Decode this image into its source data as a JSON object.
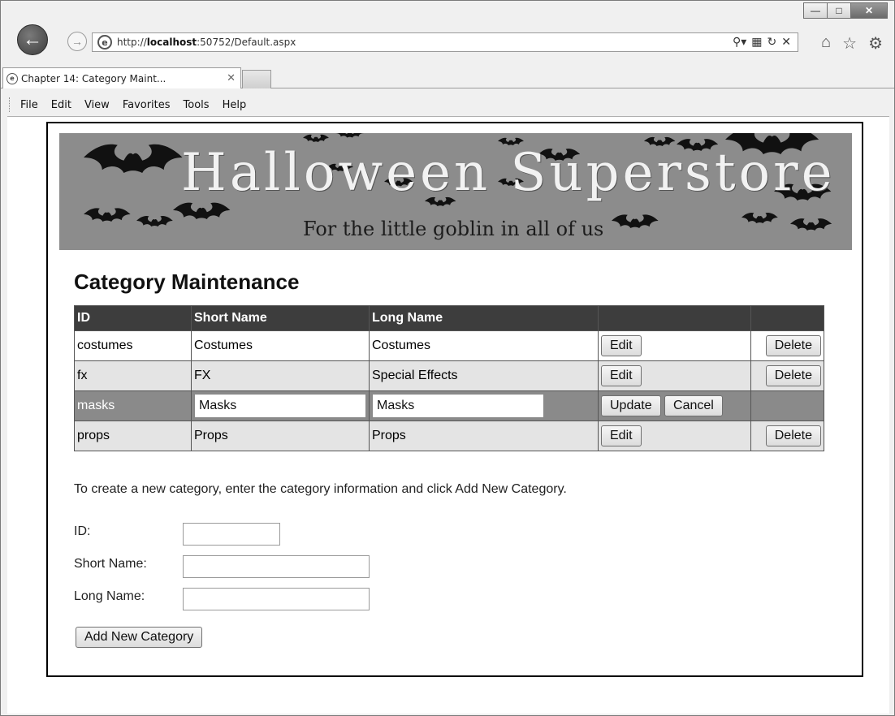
{
  "browser": {
    "url_prefix": "http://",
    "url_host": "localhost",
    "url_path": ":50752/Default.aspx",
    "tab_title": "Chapter 14: Category Maint...",
    "menu": [
      "File",
      "Edit",
      "View",
      "Favorites",
      "Tools",
      "Help"
    ]
  },
  "banner": {
    "title": "Halloween Superstore",
    "subtitle": "For the little goblin in all of us"
  },
  "page": {
    "heading": "Category Maintenance",
    "columns": [
      "ID",
      "Short Name",
      "Long Name"
    ],
    "rows": [
      {
        "id": "costumes",
        "short": "Costumes",
        "long": "Costumes"
      },
      {
        "id": "fx",
        "short": "FX",
        "long": "Special Effects"
      },
      {
        "id": "masks",
        "short": "Masks",
        "long": "Masks"
      },
      {
        "id": "props",
        "short": "Props",
        "long": "Props"
      }
    ],
    "edit_label": "Edit",
    "delete_label": "Delete",
    "update_label": "Update",
    "cancel_label": "Cancel",
    "hint": "To create a new category, enter the category information and click Add New Category.",
    "form": {
      "id_label": "ID:",
      "short_label": "Short Name:",
      "long_label": "Long Name:",
      "add_label": "Add New Category"
    }
  }
}
